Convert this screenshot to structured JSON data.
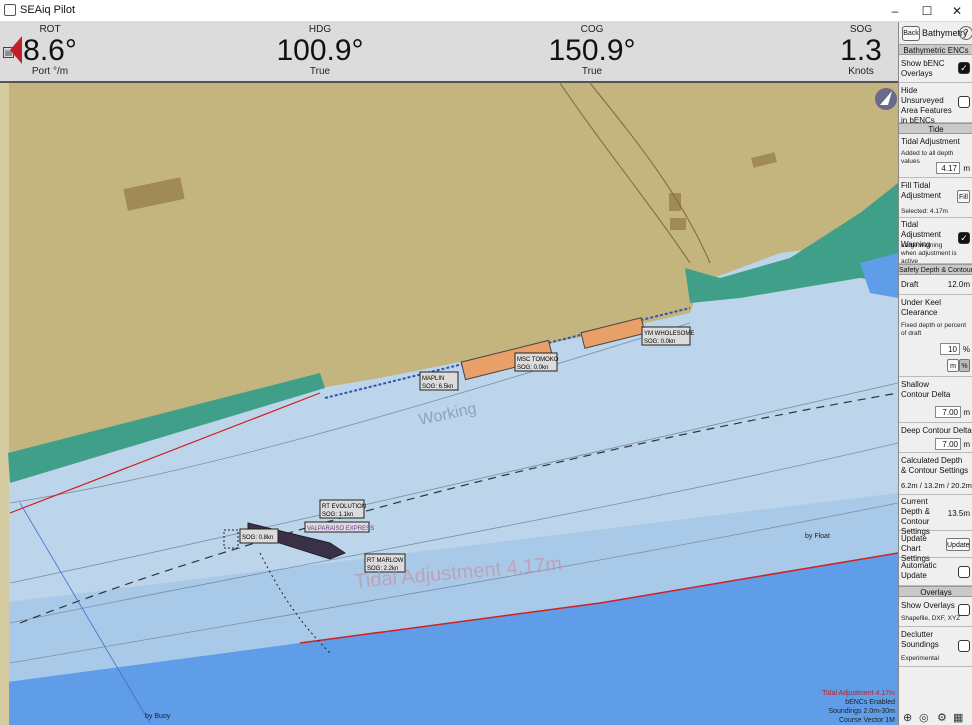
{
  "window": {
    "title": "SEAiq Pilot",
    "minimize": "–",
    "maximize": "☐",
    "close": "✕"
  },
  "instruments": {
    "rot": {
      "label": "ROT",
      "value": "8.6°",
      "unit": "Port °/m"
    },
    "hdg": {
      "label": "HDG",
      "value": "100.9°",
      "unit": "True"
    },
    "cog": {
      "label": "COG",
      "value": "150.9°",
      "unit": "True"
    },
    "sog": {
      "label": "SOG",
      "value": "1.3",
      "unit": "Knots"
    }
  },
  "sidebar": {
    "back": "Back",
    "title": "Bathymetry",
    "help": "?",
    "sec_benc": "Bathymetric ENCs",
    "show_benc": "Show bENC Overlays",
    "hide_unsurveyed": "Hide Unsurveyed Area Features in bENCs",
    "sec_tide": "Tide",
    "tidal_adj": "Tidal Adjustment",
    "tidal_adj_sub": "Added to all depth values",
    "tidal_adj_value": "4.17",
    "tidal_adj_unit": "m",
    "fill_tidal": "Fill Tidal Adjustment",
    "fill_btn": "Fill",
    "fill_sub": "Selected: 4.17m",
    "tidal_warn": "Tidal Adjustment Warning",
    "tidal_warn_sub": "Large warning when adjustment is active",
    "sec_safety": "Safety Depth & Contours",
    "draft": "Draft",
    "draft_value": "12.0m",
    "ukc": "Under Keel Clearance",
    "ukc_sub": "Fixed depth or percent of draft",
    "ukc_value": "10",
    "ukc_pct": "%",
    "ukc_m": "m",
    "ukc_pct_btn": "%",
    "shallow": "Shallow Contour Delta",
    "shallow_value": "7.00",
    "shallow_unit": "m",
    "deep": "Deep Contour Delta",
    "deep_value": "7.00",
    "deep_unit": "m",
    "calc": "Calculated Depth & Contour Settings",
    "calc_value": "6.2m / 13.2m / 20.2m",
    "current": "Current Depth & Contour Settings",
    "current_value": "13.5m",
    "update_chart": "Update Chart Settings",
    "update_btn": "Update",
    "auto_update": "Automatic Update",
    "sec_overlays": "Overlays",
    "show_overlays": "Show Overlays",
    "show_overlays_sub": "Shapefile, DXF, XYZ",
    "declutter": "Declutter Soundings",
    "declutter_sub": "Experimental"
  },
  "map": {
    "vessels": [
      {
        "name": "RT EVOLUTION",
        "sog": "SOG: 1.1kn"
      },
      {
        "name": "VALPARAISO EXPRESS",
        "sog": "SOG: 0.8kn"
      },
      {
        "name": "RT MARLOW",
        "sog": "SOG: 2.2kn"
      },
      {
        "name": "MAPLIN",
        "sog": "SOG: 6.5kn"
      },
      {
        "name": "MSC TOMOKO",
        "sog": "SOG: 0.0kn"
      },
      {
        "name": "YM WHOLESOME",
        "sog": "SOG: 0.0kn"
      }
    ],
    "watermark": "Tidal Adjustment 4.17m",
    "working_label": "Working",
    "by_buoy1": "by Buoy",
    "by_buoy2": "by Float",
    "status": [
      "Tidal Adjustment 4.17m",
      "bENCs Enabled",
      "Soundings 2.0m-30m",
      "Course Vector 1M"
    ]
  },
  "colors": {
    "land": "#c4b47e",
    "shallow": "#bcd5ea",
    "deep": "#5f9de8",
    "intertidal": "#3f9f88"
  }
}
